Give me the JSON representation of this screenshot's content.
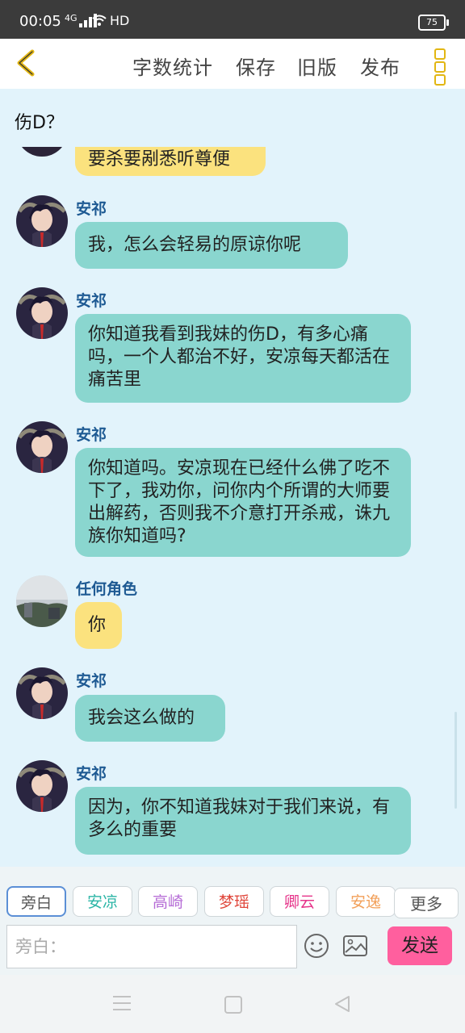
{
  "status_bar": {
    "time": "00:05",
    "network": "4G",
    "hd": "HD",
    "battery": "75"
  },
  "toolbar": {
    "word_count": "字数统计",
    "save": "保存",
    "old_version": "旧版",
    "publish": "发布"
  },
  "page": {
    "title": "伤D？"
  },
  "messages": [
    {
      "text": "要杀要剐悉听尊便",
      "color": "#fbe27e"
    },
    {
      "sender": "安祁",
      "text": "我，怎么会轻易的原谅你呢",
      "color": "#8ad6cf"
    },
    {
      "sender": "安祁",
      "text": "你知道我看到我妹的伤D，有多心痛吗，一个人都治不好，安凉每天都活在痛苦里",
      "color": "#8ad6cf"
    },
    {
      "sender": "安祁",
      "text": "你知道吗。安凉现在已经什么佛了吃不下了，我劝你，问你内个所谓的大师要出解药，否则我不介意打开杀戒，诛九族你知道吗?",
      "color": "#8ad6cf"
    },
    {
      "sender": "任何角色",
      "text": "你",
      "color": "#fbe27e"
    },
    {
      "sender": "安祁",
      "text": "我会这么做的",
      "color": "#8ad6cf"
    },
    {
      "sender": "安祁",
      "text": "因为，你不知道我妹对于我们来说，有多么的重要",
      "color": "#8ad6cf"
    }
  ],
  "characters": [
    {
      "label": "旁白",
      "color": "#555555"
    },
    {
      "label": "安凉",
      "color": "#2bb5a6"
    },
    {
      "label": "高崎",
      "color": "#b56bd6"
    },
    {
      "label": "梦瑶",
      "color": "#e0473c"
    },
    {
      "label": "卿云",
      "color": "#e6348a"
    },
    {
      "label": "安逸",
      "color": "#f2a05a"
    }
  ],
  "more_label": "更多",
  "input": {
    "placeholder": "旁白："
  },
  "send_label": "发送",
  "colors": {
    "accent": "#e2b612",
    "send": "#ff5f9e",
    "sender_name": "#1e5a93"
  }
}
